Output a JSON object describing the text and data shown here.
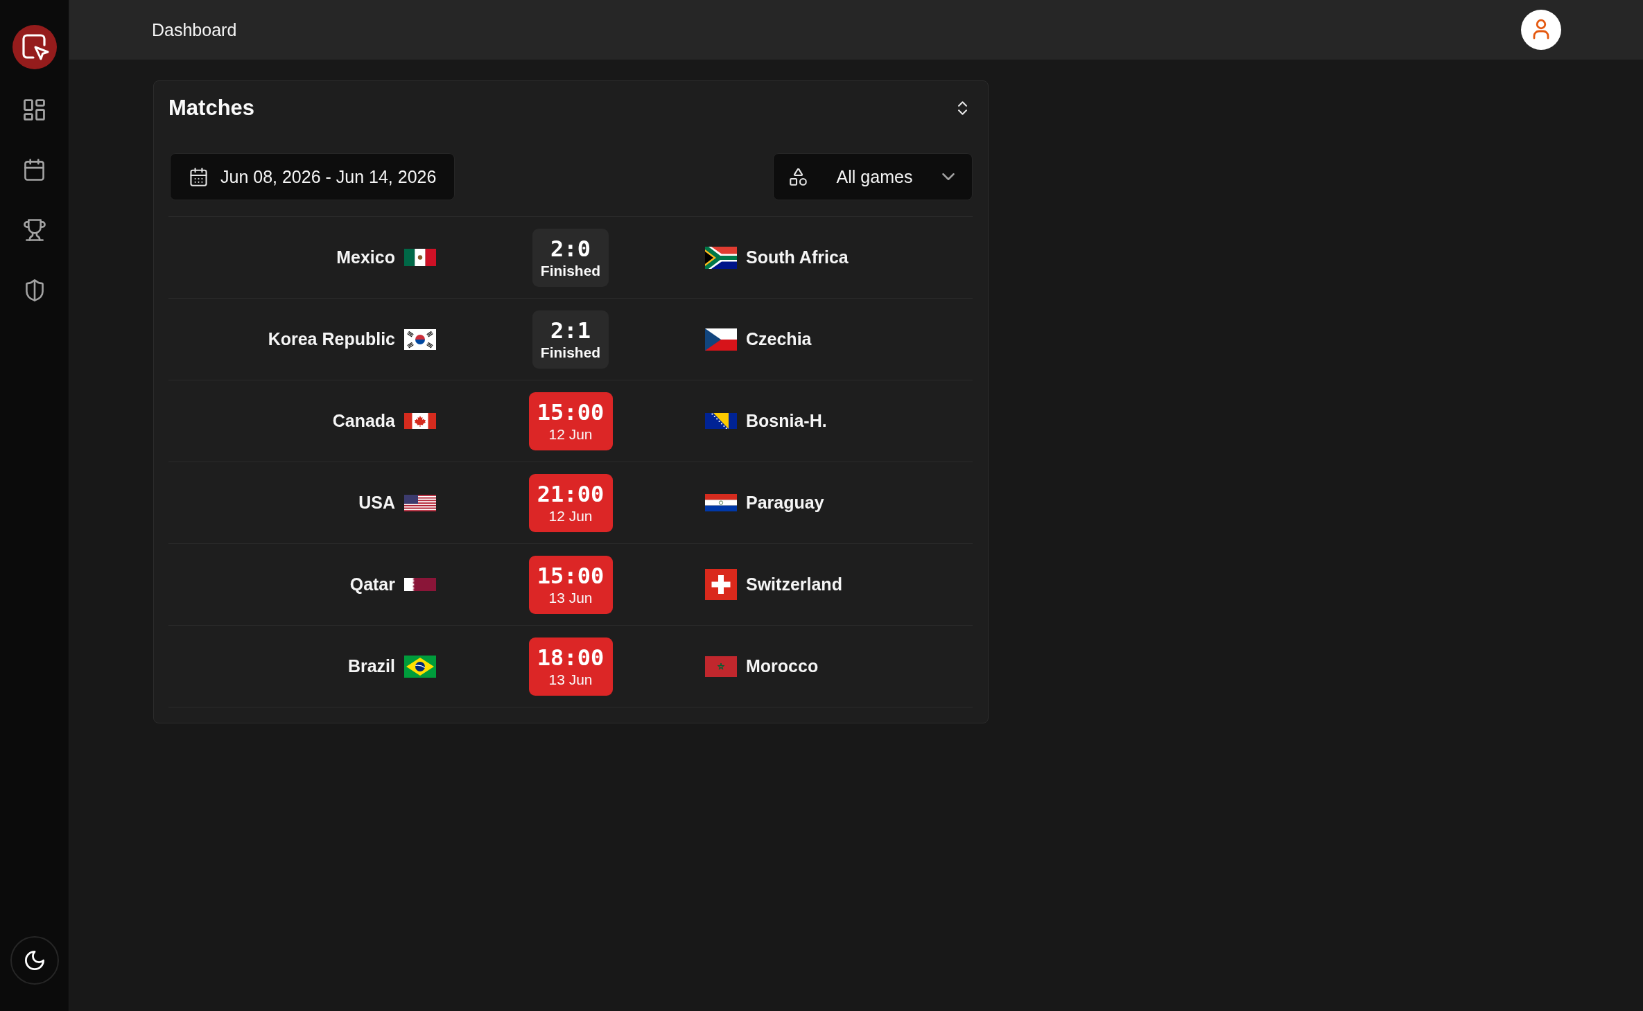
{
  "header": {
    "title": "Dashboard"
  },
  "matches": {
    "title": "Matches",
    "date_range": "Jun 08, 2026 - Jun 14, 2026",
    "filter": "All games",
    "rows": [
      {
        "home": "Mexico",
        "away": "South Africa",
        "kind": "finished",
        "score": "2:0",
        "status": "Finished"
      },
      {
        "home": "Korea Republic",
        "away": "Czechia",
        "kind": "finished",
        "score": "2:1",
        "status": "Finished"
      },
      {
        "home": "Canada",
        "away": "Bosnia-H.",
        "kind": "upcoming",
        "time": "15:00",
        "date": "12 Jun"
      },
      {
        "home": "USA",
        "away": "Paraguay",
        "kind": "upcoming",
        "time": "21:00",
        "date": "12 Jun"
      },
      {
        "home": "Qatar",
        "away": "Switzerland",
        "kind": "upcoming",
        "time": "15:00",
        "date": "13 Jun"
      },
      {
        "home": "Brazil",
        "away": "Morocco",
        "kind": "upcoming",
        "time": "18:00",
        "date": "13 Jun"
      }
    ]
  }
}
